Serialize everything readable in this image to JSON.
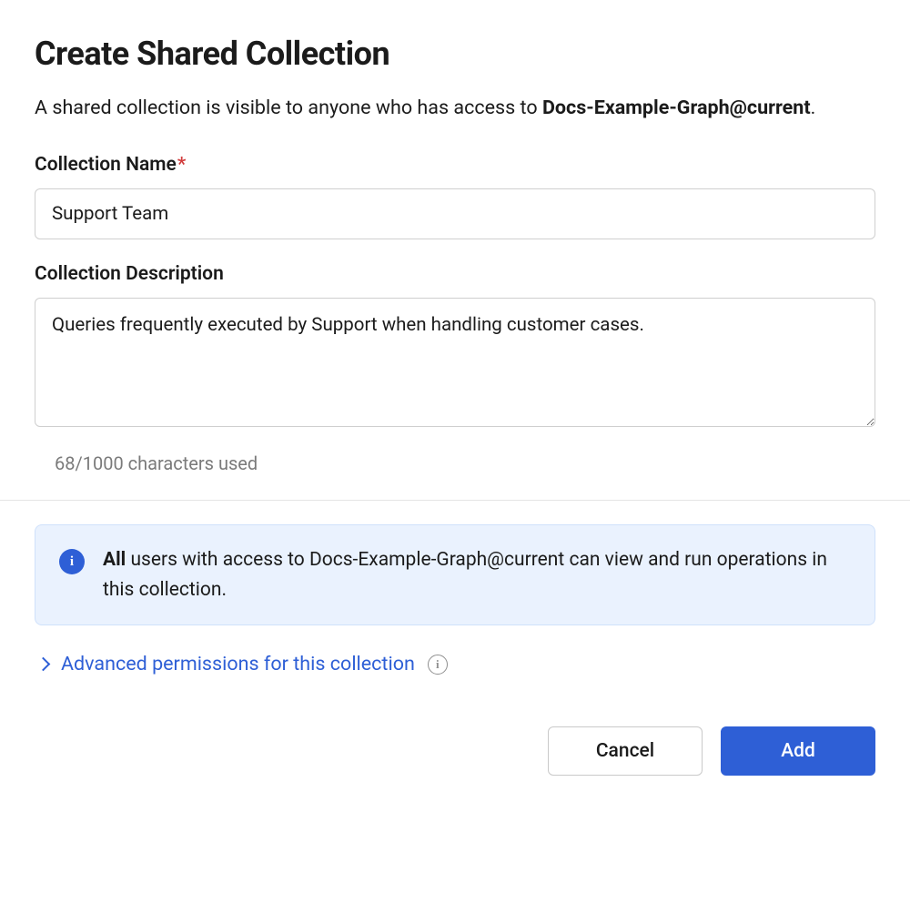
{
  "header": {
    "title": "Create Shared Collection",
    "subtitle_pre": "A shared collection is visible to anyone who has access to ",
    "subtitle_bold": "Docs-Example-Graph@current",
    "subtitle_post": "."
  },
  "form": {
    "name_label": "Collection Name",
    "name_value": "Support Team",
    "description_label": "Collection Description",
    "description_value": "Queries frequently executed by Support when handling customer cases.",
    "char_count": "68/1000 characters used"
  },
  "info": {
    "bold": "All",
    "text_rest": " users with access to Docs-Example-Graph@current can view and run operations in this collection."
  },
  "advanced": {
    "label": "Advanced permissions for this collection"
  },
  "buttons": {
    "cancel": "Cancel",
    "add": "Add"
  }
}
